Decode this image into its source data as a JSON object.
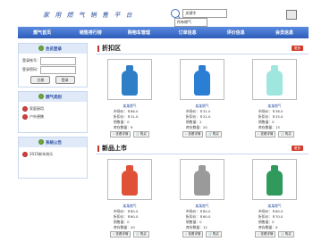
{
  "brand": "家 用 燃 气 销 售 平 台",
  "search": {
    "keyword": "关键字",
    "category": "所有燃气"
  },
  "nav": [
    "燃气首页",
    "销售排行榜",
    "购物车管理",
    "订单信息",
    "评价信息",
    "会员信息"
  ],
  "sidebar": {
    "login": {
      "title": "会员登录",
      "username_label": "登录帐号：",
      "password_label": "登录密码：",
      "login_button": "注册",
      "register_button": "登录"
    },
    "category": {
      "title": "燃气类别",
      "items": [
        "家庭厨用",
        "户外便携"
      ]
    },
    "notice": {
      "title": "系统公告",
      "items": [
        "2015新年快乐"
      ]
    }
  },
  "discount": {
    "title": "折扣区",
    "more": "更多",
    "products": [
      {
        "name": "某某燃气",
        "market": "市场价：￥86.0",
        "discount": "折扣价：￥31.0",
        "sold": "销售量：0",
        "stock": "库存数量：9",
        "view": "查看详情",
        "buy": "购买",
        "color": "#2f7fc7"
      },
      {
        "name": "某某燃气",
        "market": "市场价：￥31.0",
        "discount": "折扣价：￥21.0",
        "sold": "销售量：2",
        "stock": "库存数量：20",
        "view": "查看详情",
        "buy": "购买",
        "color": "#2a7ed4"
      },
      {
        "name": "某某燃气",
        "market": "市场价：￥36.0",
        "discount": "折扣价：￥25.0",
        "sold": "销售量：0",
        "stock": "库存数量：13",
        "view": "查看详情",
        "buy": "购买",
        "color": "#9fe6de"
      }
    ]
  },
  "newarrivals": {
    "title": "新品上市",
    "more": "更多",
    "products": [
      {
        "name": "某某燃气",
        "market": "市场价：￥80.0",
        "discount": "折扣价：￥60.0",
        "sold": "销售量：0",
        "stock": "库存数量：20",
        "view": "查看详情",
        "buy": "购买",
        "color": "#e05238"
      },
      {
        "name": "某某燃气",
        "market": "市场价：￥80.0",
        "discount": "折扣价：￥60.0",
        "sold": "销售量：0",
        "stock": "库存数量：12",
        "view": "查看详情",
        "buy": "购买",
        "color": "#9a9a9a"
      },
      {
        "name": "某某燃气",
        "market": "市场价：￥80.0",
        "discount": "折扣价：￥70.0",
        "sold": "销售量：0",
        "stock": "库存数量：9",
        "view": "查看详情",
        "buy": "购买",
        "color": "#2f9a5c"
      }
    ]
  }
}
